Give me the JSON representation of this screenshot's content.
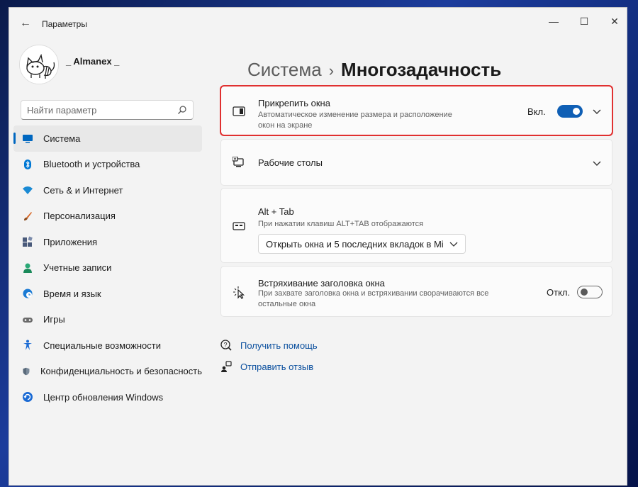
{
  "window": {
    "title": "Параметры",
    "controls": {
      "minimize": "—",
      "maximize": "☐",
      "close": "✕"
    },
    "back": "←"
  },
  "profile": {
    "name": "_ Almanex _"
  },
  "search": {
    "placeholder": "Найти параметр"
  },
  "sidebar": {
    "items": [
      {
        "label": "Система",
        "icon": "monitor-icon",
        "selected": true,
        "color": "#0067c0"
      },
      {
        "label": "Bluetooth и устройства",
        "icon": "bluetooth-icon",
        "color": "#0078d4"
      },
      {
        "label": "Сеть & и Интернет",
        "icon": "wifi-icon",
        "color": "#1a8ad4"
      },
      {
        "label": "Персонализация",
        "icon": "brush-icon",
        "color": "#d86a2a"
      },
      {
        "label": "Приложения",
        "icon": "apps-icon",
        "color": "#4a5a7a"
      },
      {
        "label": "Учетные записи",
        "icon": "person-icon",
        "color": "#2aa876"
      },
      {
        "label": "Время и язык",
        "icon": "globe-clock-icon",
        "color": "#1a7ad4"
      },
      {
        "label": "Игры",
        "icon": "gamepad-icon",
        "color": "#6a6a6a"
      },
      {
        "label": "Специальные возможности",
        "icon": "accessibility-icon",
        "color": "#1a6ad4"
      },
      {
        "label": "Конфиденциальность и безопасность",
        "icon": "shield-icon",
        "color": "#6a7a8a"
      },
      {
        "label": "Центр обновления Windows",
        "icon": "update-icon",
        "color": "#1a6ad4"
      }
    ]
  },
  "breadcrumb": {
    "parent": "Система",
    "separator": "›",
    "current": "Многозадачность"
  },
  "cards": {
    "snap": {
      "title": "Прикрепить окна",
      "description": "Автоматическое изменение размера и расположение окон на экране",
      "state_label": "Вкл.",
      "enabled": true
    },
    "desktops": {
      "title": "Рабочие столы"
    },
    "alttab": {
      "title": "Alt + Tab",
      "description": "При нажатии клавиш ALT+TAB отображаются",
      "selected_option": "Открыть окна и 5 последних вкладок в Mi"
    },
    "shake": {
      "title": "Встряхивание заголовка окна",
      "description": "При захвате заголовка окна и встряхивании сворачиваются все остальные окна",
      "state_label": "Откл.",
      "enabled": false
    }
  },
  "links": {
    "help": "Получить помощь",
    "feedback": "Отправить отзыв"
  },
  "colors": {
    "accent": "#0f5fb5",
    "highlight": "#e03030",
    "link": "#0a4f9e"
  }
}
